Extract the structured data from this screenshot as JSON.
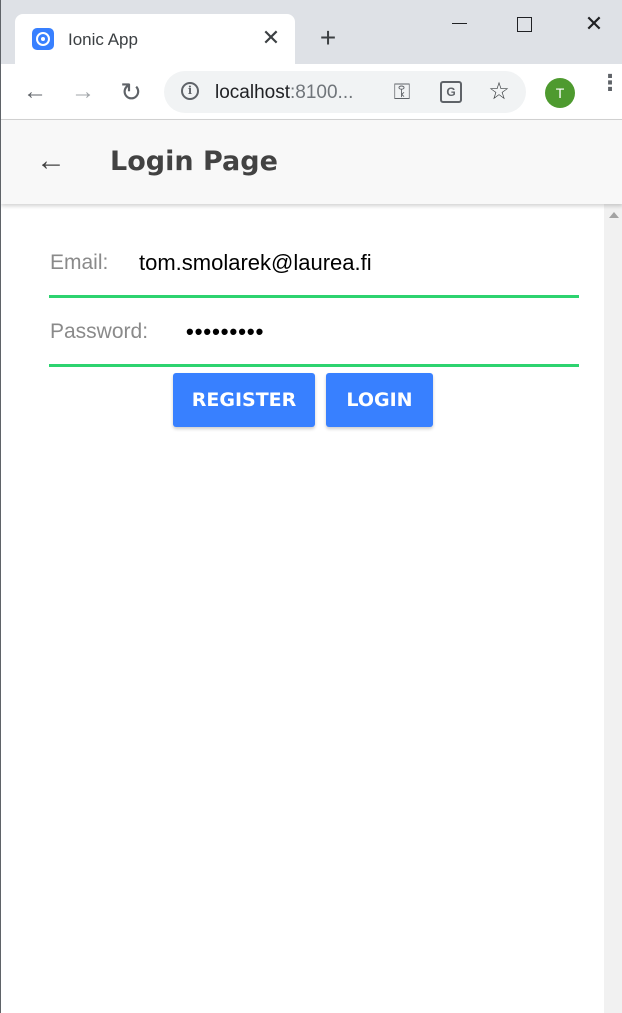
{
  "browser": {
    "tab": {
      "title": "Ionic App",
      "close_glyph": "✕",
      "favicon": "ionic-icon"
    },
    "new_tab_glyph": "+",
    "window_controls": {
      "minimize": "",
      "maximize": "",
      "close": "✕"
    },
    "nav": {
      "back_glyph": "←",
      "forward_glyph": "→",
      "reload_glyph": "↻"
    },
    "address": {
      "host": "localhost",
      "rest": ":8100..."
    },
    "omnibox_icons": {
      "info": "i",
      "key": "⚿",
      "translate": "G",
      "star": "☆"
    },
    "profile_initial": "T",
    "menu_glyph": "⋮"
  },
  "app": {
    "header": {
      "back_glyph": "←",
      "title": "Login Page"
    },
    "form": {
      "email_label": "Email:",
      "email_value": "tom.smolarek@laurea.fi",
      "password_label": "Password:",
      "password_value": "•••••••••"
    },
    "buttons": {
      "register": "REGISTER",
      "login": "LOGIN"
    }
  },
  "colors": {
    "primary": "#3880ff",
    "success_underline": "#2dd36f",
    "profile": "#4e9a2f"
  }
}
